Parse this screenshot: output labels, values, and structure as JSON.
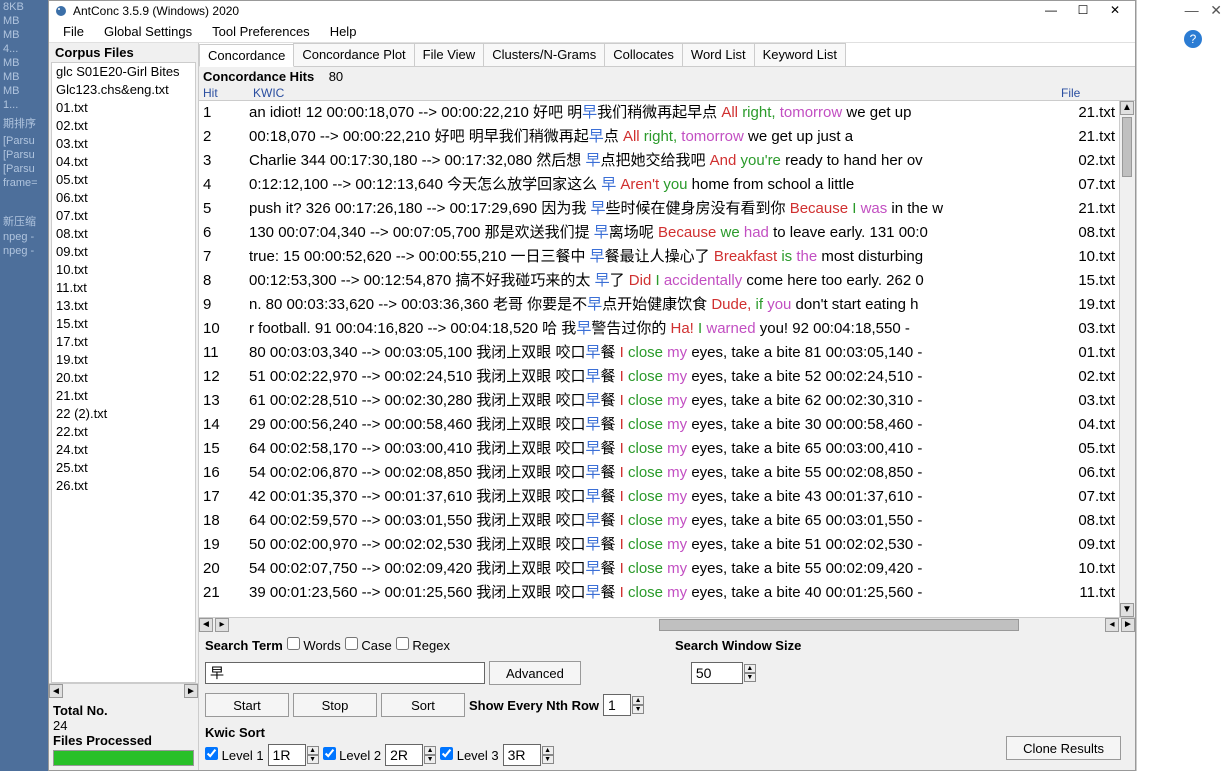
{
  "bg_left_items": [
    "8KB",
    "MB",
    "MB",
    "4...",
    "MB",
    "MB",
    "MB",
    "1...",
    "",
    "期排序",
    "",
    "[Parsu",
    "[Parsu",
    "[Parsu",
    "frame=",
    "",
    "",
    "",
    "",
    "",
    "",
    "",
    "",
    "",
    "",
    "",
    "新压缩",
    "npeg -",
    "npeg -"
  ],
  "window": {
    "title": "AntConc 3.5.9 (Windows) 2020",
    "min": "—",
    "max": "☐",
    "close": "✕"
  },
  "menu": {
    "file": "File",
    "global": "Global Settings",
    "toolprefs": "Tool Preferences",
    "help": "Help"
  },
  "sidebar": {
    "header": "Corpus Files",
    "files": [
      "glc S01E20-Girl Bites",
      "Glc123.chs&eng.txt",
      "01.txt",
      "02.txt",
      "03.txt",
      "04.txt",
      "05.txt",
      "06.txt",
      "07.txt",
      "08.txt",
      "09.txt",
      "10.txt",
      "11.txt",
      "13.txt",
      "15.txt",
      "17.txt",
      "19.txt",
      "20.txt",
      "21.txt",
      "22 (2).txt",
      "22.txt",
      "24.txt",
      "25.txt",
      "26.txt"
    ],
    "total_label": "Total No.",
    "total_value": "24",
    "processed_label": "Files Processed"
  },
  "tabs": [
    "Concordance",
    "Concordance Plot",
    "File View",
    "Clusters/N-Grams",
    "Collocates",
    "Word List",
    "Keyword List"
  ],
  "active_tab": 0,
  "hits": {
    "label": "Concordance Hits",
    "value": "80"
  },
  "cols": {
    "hit": "Hit",
    "kwic": "KWIC",
    "file": "File"
  },
  "rows": [
    {
      "n": "1",
      "pre": "an idiot!  12 00:00:18,070 --> 00:00:22,210 好吧  明",
      "kw": "早",
      "post1": "我们稍微再起早点 ",
      "r": "All ",
      "g": "right, ",
      "p": "tomorrow ",
      "post2": "we get up",
      "file": "21.txt"
    },
    {
      "n": "2",
      "pre": "00:18,070 --> 00:00:22,210 好吧  明早我们稍微再起",
      "kw": "早",
      "post1": "点 ",
      "r": "All ",
      "g": "right, ",
      "p": "tomorrow ",
      "post2": "we get up just a",
      "file": "21.txt"
    },
    {
      "n": "3",
      "pre": " Charlie  344 00:17:30,180 --> 00:17:32,080 然后想 ",
      "kw": "早",
      "post1": "点把她交给我吧 ",
      "r": "And ",
      "g": "you're ",
      "p": "",
      "post2": "ready to hand her ov",
      "file": "02.txt"
    },
    {
      "n": "4",
      "pre": "0:12:12,100 --> 00:12:13,640 今天怎么放学回家这么 ",
      "kw": "早 ",
      "post1": "",
      "r": "Aren't ",
      "g": "you ",
      "p": "",
      "post2": "home from school a little",
      "file": "07.txt"
    },
    {
      "n": "5",
      "pre": "push it?  326 00:17:26,180 --> 00:17:29,690 因为我 ",
      "kw": "早",
      "post1": "些时候在健身房没有看到你 ",
      "r": "Because ",
      "g": "I ",
      "p": "was ",
      "post2": "in the w",
      "file": "21.txt"
    },
    {
      "n": "6",
      "pre": " 130 00:07:04,340 --> 00:07:05,700 那是欢送我们提 ",
      "kw": "早",
      "post1": "离场呢 ",
      "r": "Because ",
      "g": "we ",
      "p": "had ",
      "post2": "to leave early.  131 00:0",
      "file": "08.txt"
    },
    {
      "n": "7",
      "pre": "true:  15 00:00:52,620 --> 00:00:55,210 一日三餐中 ",
      "kw": "早",
      "post1": "餐最让人操心了 ",
      "r": "Breakfast ",
      "g": "is ",
      "p": "the ",
      "post2": "most disturbing",
      "file": "10.txt"
    },
    {
      "n": "8",
      "pre": " 00:12:53,300 --> 00:12:54,870 搞不好我碰巧来的太 ",
      "kw": "早",
      "post1": "了 ",
      "r": "Did ",
      "g": "I ",
      "p": "accidentally ",
      "post2": "come here too early.  262 0",
      "file": "15.txt"
    },
    {
      "n": "9",
      "pre": "n.  80 00:03:33,620 --> 00:03:36,360 老哥  你要是不",
      "kw": "早",
      "post1": "点开始健康饮食 ",
      "r": "Dude, ",
      "g": "if ",
      "p": "you ",
      "post2": "don't start eating h",
      "file": "19.txt"
    },
    {
      "n": "10",
      "pre": "r football.  91 00:04:16,820 --> 00:04:18,520 哈  我",
      "kw": "早",
      "post1": "警告过你的  ",
      "r": "Ha! ",
      "g": "I ",
      "p": "warned ",
      "post2": "you!  92 00:04:18,550 -",
      "file": "03.txt"
    },
    {
      "n": "11",
      "pre": "80 00:03:03,340 --> 00:03:05,100 我闭上双眼  咬口",
      "kw": "早",
      "post1": "餐 ",
      "r": "I ",
      "g": "close ",
      "p": "my ",
      "post2": "eyes, take a bite  81 00:03:05,140 -",
      "file": "01.txt"
    },
    {
      "n": "12",
      "pre": "51 00:02:22,970 --> 00:02:24,510 我闭上双眼  咬口",
      "kw": "早",
      "post1": "餐 ",
      "r": "I ",
      "g": "close ",
      "p": "my ",
      "post2": "eyes, take a bite  52 00:02:24,510 -",
      "file": "02.txt"
    },
    {
      "n": "13",
      "pre": "61 00:02:28,510 --> 00:02:30,280 我闭上双眼  咬口",
      "kw": "早",
      "post1": "餐 ",
      "r": "I ",
      "g": "close ",
      "p": "my ",
      "post2": "eyes, take a bite  62 00:02:30,310 -",
      "file": "03.txt"
    },
    {
      "n": "14",
      "pre": "29 00:00:56,240 --> 00:00:58,460 我闭上双眼  咬口",
      "kw": "早",
      "post1": "餐 ",
      "r": "I ",
      "g": "close ",
      "p": "my ",
      "post2": "eyes, take a bite  30 00:00:58,460 -",
      "file": "04.txt"
    },
    {
      "n": "15",
      "pre": "64 00:02:58,170 --> 00:03:00,410 我闭上双眼  咬口",
      "kw": "早",
      "post1": "餐 ",
      "r": "I ",
      "g": "close ",
      "p": "my ",
      "post2": "eyes, take a bite  65 00:03:00,410 -",
      "file": "05.txt"
    },
    {
      "n": "16",
      "pre": "54 00:02:06,870 --> 00:02:08,850 我闭上双眼  咬口",
      "kw": "早",
      "post1": "餐 ",
      "r": "I ",
      "g": "close ",
      "p": "my ",
      "post2": "eyes, take a bite  55 00:02:08,850 -",
      "file": "06.txt"
    },
    {
      "n": "17",
      "pre": "42 00:01:35,370 --> 00:01:37,610 我闭上双眼  咬口",
      "kw": "早",
      "post1": "餐 ",
      "r": "I ",
      "g": "close ",
      "p": "my ",
      "post2": "eyes, take a bite  43 00:01:37,610 -",
      "file": "07.txt"
    },
    {
      "n": "18",
      "pre": "64 00:02:59,570 --> 00:03:01,550 我闭上双眼  咬口",
      "kw": "早",
      "post1": "餐 ",
      "r": "I ",
      "g": "close ",
      "p": "my ",
      "post2": "eyes, take a bite  65 00:03:01,550 -",
      "file": "08.txt"
    },
    {
      "n": "19",
      "pre": "50 00:02:00,970 --> 00:02:02,530 我闭上双眼  咬口",
      "kw": "早",
      "post1": "餐 ",
      "r": "I ",
      "g": "close ",
      "p": "my ",
      "post2": "eyes, take a bite  51 00:02:02,530 -",
      "file": "09.txt"
    },
    {
      "n": "20",
      "pre": "54 00:02:07,750 --> 00:02:09,420 我闭上双眼  咬口",
      "kw": "早",
      "post1": "餐 ",
      "r": "I ",
      "g": "close ",
      "p": "my ",
      "post2": "eyes, take a bite  55 00:02:09,420 -",
      "file": "10.txt"
    },
    {
      "n": "21",
      "pre": "39 00:01:23,560 --> 00:01:25,560 我闭上双眼  咬口",
      "kw": "早",
      "post1": "餐 ",
      "r": "I ",
      "g": "close ",
      "p": "my ",
      "post2": "eyes, take a bite  40 00:01:25,560 -",
      "file": "11.txt"
    }
  ],
  "controls": {
    "search_term": "Search Term",
    "words": "Words",
    "case": "Case",
    "regex": "Regex",
    "search_value": "早",
    "advanced": "Advanced",
    "start": "Start",
    "stop": "Stop",
    "sort": "Sort",
    "show_every": "Show Every Nth Row",
    "nth": "1",
    "window_label": "Search Window Size",
    "window_value": "50",
    "kwic_sort": "Kwic Sort",
    "level1": "Level 1",
    "l1v": "1R",
    "level2": "Level 2",
    "l2v": "2R",
    "level3": "Level 3",
    "l3v": "3R",
    "clone": "Clone Results"
  }
}
